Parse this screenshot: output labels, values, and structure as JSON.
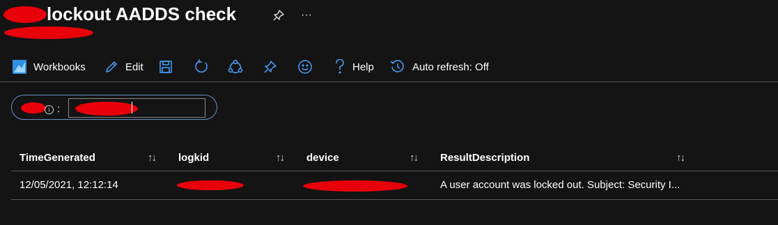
{
  "header": {
    "title": "lockout AADDS check",
    "pin_icon": "pin-icon",
    "more_icon": "ellipsis-icon",
    "more_glyph": "···"
  },
  "toolbar": {
    "workbooks_label": "Workbooks",
    "edit_label": "Edit",
    "help_label": "Help",
    "auto_refresh_label": "Auto refresh: Off",
    "icons": [
      "workbooks-icon",
      "edit-icon",
      "save-icon",
      "refresh-icon",
      "share-icon",
      "pin-icon",
      "feedback-icon",
      "help-icon",
      "auto-refresh-icon"
    ]
  },
  "parameter": {
    "colon": ":",
    "info_glyph": "i",
    "value": ""
  },
  "grid": {
    "columns": [
      {
        "label": "TimeGenerated",
        "sort": "↑↓"
      },
      {
        "label": "logkid",
        "sort": "↑↓"
      },
      {
        "label": "device",
        "sort": "↑↓"
      },
      {
        "label": "ResultDescription",
        "sort": "↑↓"
      }
    ],
    "rows": [
      {
        "time_generated": "12/05/2021, 12:12:14",
        "logkid": "",
        "device": "",
        "result_description": "A user account was locked out. Subject: Security I..."
      }
    ]
  },
  "colors": {
    "background": "#141414",
    "redaction": "#e8000b",
    "accent_blue": "#2f8fe0",
    "pill_border": "#6b8fc7"
  }
}
